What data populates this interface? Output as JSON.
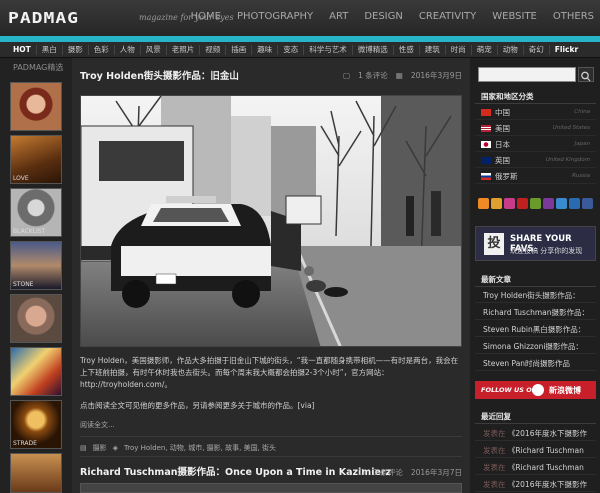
{
  "header": {
    "logo": "PADMAG",
    "tagline": "magazine for your eyes",
    "nav": [
      "HOME",
      "PHOTOGRAPHY",
      "ART",
      "DESIGN",
      "CREATIVITY",
      "WEBSITE",
      "OTHERS"
    ]
  },
  "categories": [
    "HOT",
    "黑白",
    "摄影",
    "色彩",
    "人物",
    "风景",
    "老照片",
    "视频",
    "插画",
    "趣味",
    "变态",
    "科学与艺术",
    "微博精选",
    "性感",
    "建筑",
    "时尚",
    "萌宠",
    "动物",
    "奇幻",
    "Flickr"
  ],
  "left": {
    "title": "PADMAG精选",
    "captions": [
      "LOVE",
      "BLACKLIST",
      "STONE",
      "",
      "",
      "STRADE",
      ""
    ]
  },
  "post1": {
    "title": "Troy Holden街头摄影作品：旧金山",
    "comments": "1 条评论",
    "date": "2016年3月9日",
    "body1": "Troy Holden，美国摄影师，作品大多拍摄于旧金山下城的街头，“我一直都随身携带相机——有时是两台，我会在上下班前拍摄，有时午休时我也去街头。而每个周末我大概都会拍摄2-3个小时”，官方网站：http://troyholden.com/。",
    "body2": "点击阅读全文可见他的更多作品，另请参阅更多关于城市的作品。[via]",
    "readmore": "阅读全文...",
    "category": "摄影",
    "tags": "Troy Holden, 动物, 城市, 摄影, 故事, 美国, 街头"
  },
  "post2": {
    "title": "Richard Tuschman摄影作品：Once Upon a Time in Kazimierz",
    "comments": "1 条评论",
    "date": "2016年3月7日"
  },
  "sidebar": {
    "search_placeholder": "",
    "regions_title": "国家和地区分类",
    "regions": [
      {
        "cn": "中国",
        "en": "China"
      },
      {
        "cn": "美国",
        "en": "United States"
      },
      {
        "cn": "日本",
        "en": "Japan"
      },
      {
        "cn": "英国",
        "en": "United Kingdom"
      },
      {
        "cn": "俄罗斯",
        "en": "Russia"
      }
    ],
    "share_title": "SHARE YOUR FAVS",
    "share_sub": "欢迎投稿 分享你的发现",
    "share_icon": "投",
    "latest_title": "最新文章",
    "latest": [
      "Troy Holden街头摄影作品：",
      "Richard Tuschman摄影作品：",
      "Steven Rubin黑白摄影作品：",
      "Simona Ghizzoni摄影作品：",
      "Steven Pan时尚摄影作品"
    ],
    "weibo_follow": "FOLLOW US ON",
    "weibo_name": "新浪微博",
    "replies_title": "最近回复",
    "replies": [
      {
        "by": "发表在",
        "q": "《2016年度水下摄影作"
      },
      {
        "by": "发表在",
        "q": "《Richard Tuschman"
      },
      {
        "by": "发表在",
        "q": "《Richard Tuschman"
      },
      {
        "by": "发表在",
        "q": "《2016年度水下摄影作"
      }
    ],
    "colors": {
      "accent": "#25b4c8",
      "weibo": "#c8202a"
    }
  }
}
